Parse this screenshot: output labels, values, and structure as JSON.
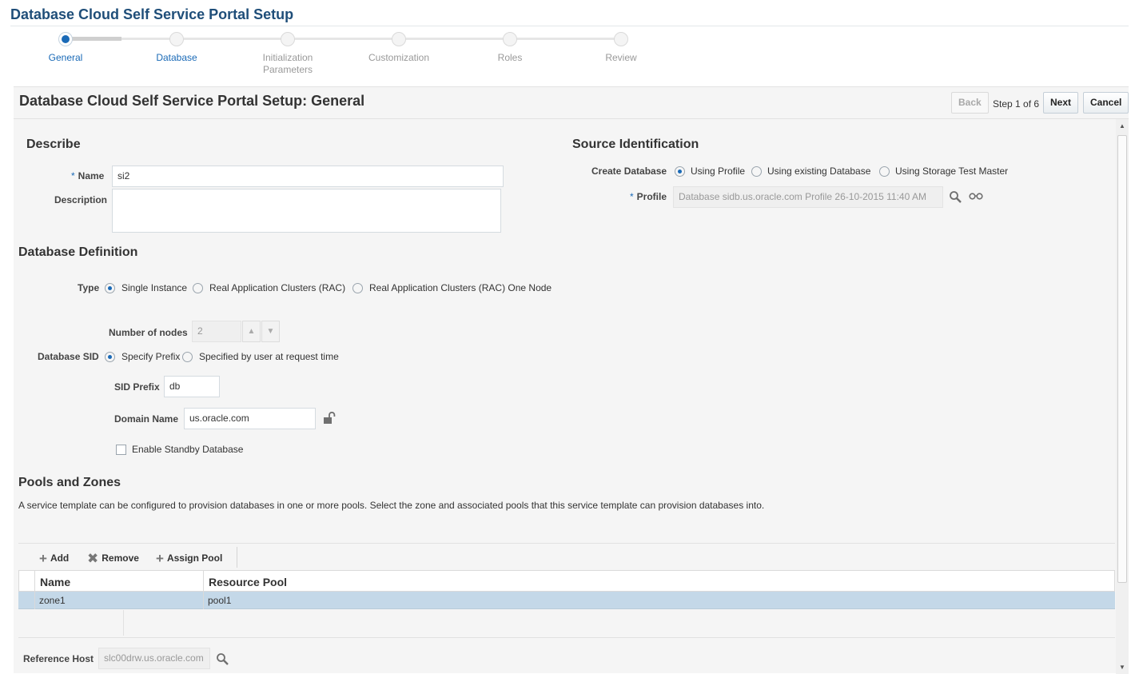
{
  "app": {
    "title": "Database Cloud Self Service Portal Setup"
  },
  "train": {
    "steps": [
      {
        "label": "General"
      },
      {
        "label": "Database"
      },
      {
        "label": "Initialization Parameters"
      },
      {
        "label": "Customization"
      },
      {
        "label": "Roles"
      },
      {
        "label": "Review"
      }
    ]
  },
  "header": {
    "title": "Database Cloud Self Service Portal Setup: General",
    "back_label": "Back",
    "step_text": "Step 1 of 6",
    "next_label": "Next",
    "cancel_label": "Cancel"
  },
  "describe": {
    "heading": "Describe",
    "name_label": "Name",
    "name_value": "si2",
    "description_label": "Description",
    "description_value": ""
  },
  "source": {
    "heading": "Source Identification",
    "create_label": "Create Database",
    "options": [
      "Using Profile",
      "Using existing Database",
      "Using Storage Test Master"
    ],
    "selected": "Using Profile",
    "profile_label": "Profile",
    "profile_value": "Database sidb.us.oracle.com Profile 26-10-2015 11:40 AM"
  },
  "db_def": {
    "heading": "Database Definition",
    "type_label": "Type",
    "type_options": [
      "Single Instance",
      "Real Application Clusters (RAC)",
      "Real Application Clusters (RAC) One Node"
    ],
    "type_selected": "Single Instance",
    "nodes_label": "Number of nodes",
    "nodes_value": "2",
    "sid_label": "Database SID",
    "sid_options": [
      "Specify Prefix",
      "Specified by user at request time"
    ],
    "sid_selected": "Specify Prefix",
    "sid_prefix_label": "SID Prefix",
    "sid_prefix_value": "db",
    "domain_label": "Domain Name",
    "domain_value": "us.oracle.com",
    "standby_label": "Enable Standby Database",
    "standby_checked": false
  },
  "pools": {
    "heading": "Pools and Zones",
    "description": "A service template can be configured to provision databases in one or more pools. Select the zone and associated pools that this service template can provision databases into.",
    "toolbar": {
      "add": "Add",
      "remove": "Remove",
      "assign": "Assign Pool"
    },
    "columns": [
      "Name",
      "Resource Pool"
    ],
    "rows": [
      {
        "name": "zone1",
        "pool": "pool1"
      }
    ]
  },
  "reference": {
    "label": "Reference Host",
    "value": "slc00drw.us.oracle.com"
  },
  "colors": {
    "accent": "#1a6ab7",
    "title": "#1f4e79",
    "selected_row": "#c4d8e8"
  },
  "icons": [
    "search-icon",
    "glasses-icon",
    "unlock-icon",
    "add-icon",
    "remove-icon",
    "assign-icon"
  ]
}
